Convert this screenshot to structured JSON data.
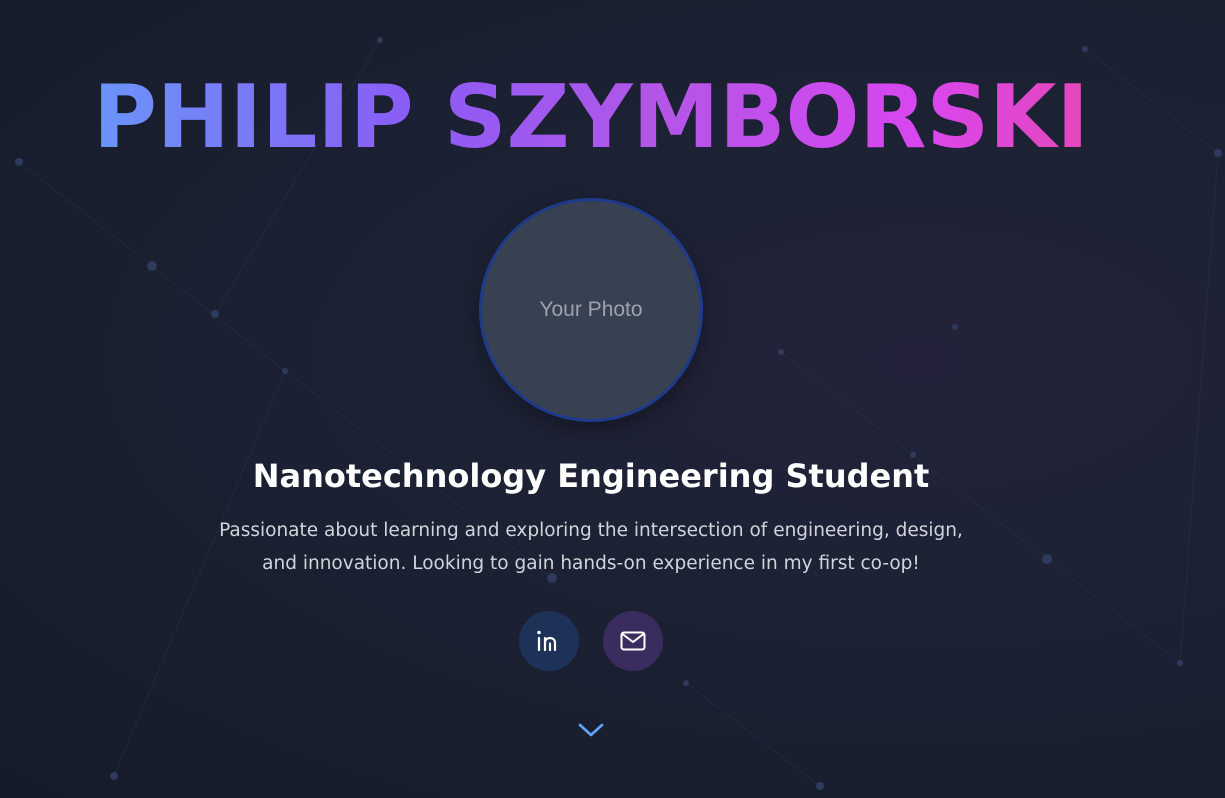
{
  "hero": {
    "name": "PHILIP SZYMBORSKI",
    "photo_placeholder": "Your Photo",
    "subtitle": "Nanotechnology Engineering Student",
    "description": "Passionate about learning and exploring the intersection of engineering, design, and innovation. Looking to gain hands-on experience in my first co-op!"
  },
  "social": {
    "linkedin_icon": "linkedin-icon",
    "email_icon": "mail-icon"
  },
  "scroll": {
    "icon": "chevron-down-icon"
  },
  "colors": {
    "background": "#1c2234",
    "gradient_start": "#60a5fa",
    "gradient_mid": "#a855f7",
    "gradient_end": "#ec4899",
    "photo_fill": "#374151",
    "photo_border": "#1e3a8a",
    "linkedin_button": "#1e3158",
    "email_button": "#3b2c5f",
    "chevron": "#60a5fa"
  }
}
